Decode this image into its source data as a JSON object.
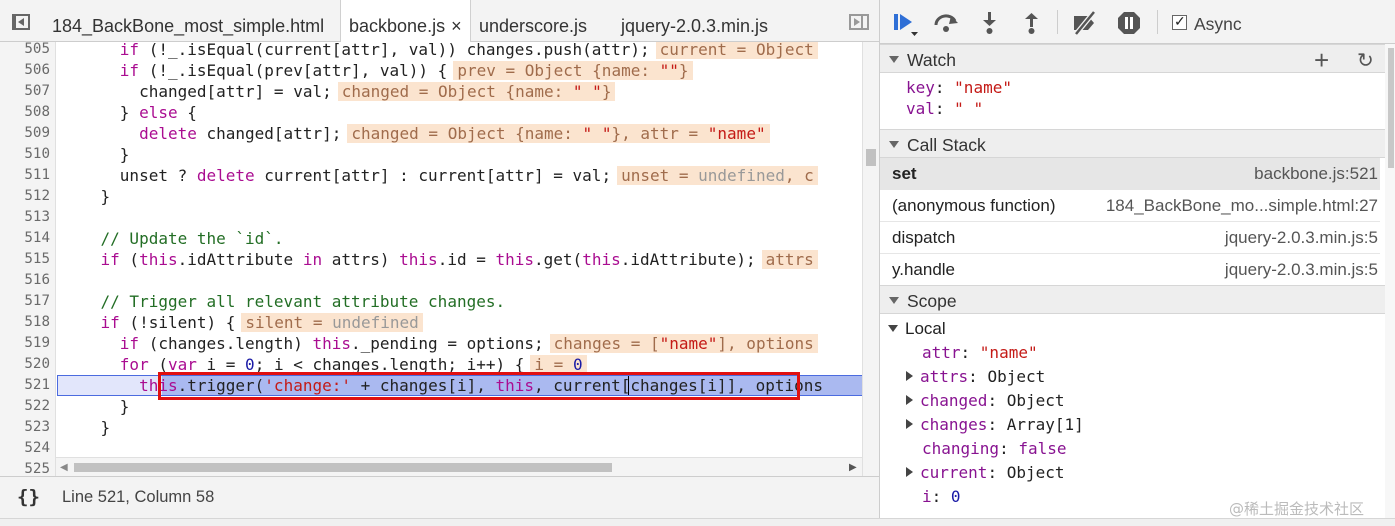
{
  "tabs": {
    "items": [
      {
        "label": "184_BackBone_most_simple.html"
      },
      {
        "label": "backbone.js",
        "close": "×"
      },
      {
        "label": "underscore.js"
      },
      {
        "label": "jquery-2.0.3.min.js"
      }
    ]
  },
  "editor": {
    "line_numbers": [
      "505",
      "506",
      "507",
      "508",
      "509",
      "510",
      "511",
      "512",
      "513",
      "514",
      "515",
      "516",
      "517",
      "518",
      "519",
      "520",
      "521",
      "522",
      "523",
      "524",
      "525"
    ],
    "current_line": "521"
  },
  "status": {
    "braces": "{}",
    "position": "Line 521, Column 58"
  },
  "debugger": {
    "async_label": "Async",
    "async_checked": true,
    "watch": {
      "title": "Watch",
      "add": "+",
      "refresh": "↻",
      "items": [
        {
          "name": "key",
          "value": "\"name\""
        },
        {
          "name": "val",
          "value": "\" \""
        }
      ]
    },
    "call_stack": {
      "title": "Call Stack",
      "frames": [
        {
          "fn": "set",
          "loc": "backbone.js:521"
        },
        {
          "fn": "(anonymous function)",
          "loc": "184_BackBone_mo...simple.html:27"
        },
        {
          "fn": "dispatch",
          "loc": "jquery-2.0.3.min.js:5"
        },
        {
          "fn": "y.handle",
          "loc": "jquery-2.0.3.min.js:5"
        }
      ]
    },
    "scope": {
      "title": "Scope",
      "local_label": "Local",
      "vars": [
        {
          "name": "attr",
          "value": "\"name\"",
          "kind": "string",
          "expandable": false
        },
        {
          "name": "attrs",
          "value": "Object",
          "kind": "object",
          "expandable": true
        },
        {
          "name": "changed",
          "value": "Object",
          "kind": "object",
          "expandable": true
        },
        {
          "name": "changes",
          "value": "Array[1]",
          "kind": "object",
          "expandable": true
        },
        {
          "name": "changing",
          "value": "false",
          "kind": "bool",
          "expandable": false
        },
        {
          "name": "current",
          "value": "Object",
          "kind": "object",
          "expandable": true
        },
        {
          "name": "i",
          "value": "0",
          "kind": "number",
          "expandable": false
        }
      ]
    }
  },
  "watermark": "@稀土掘金技术社区"
}
